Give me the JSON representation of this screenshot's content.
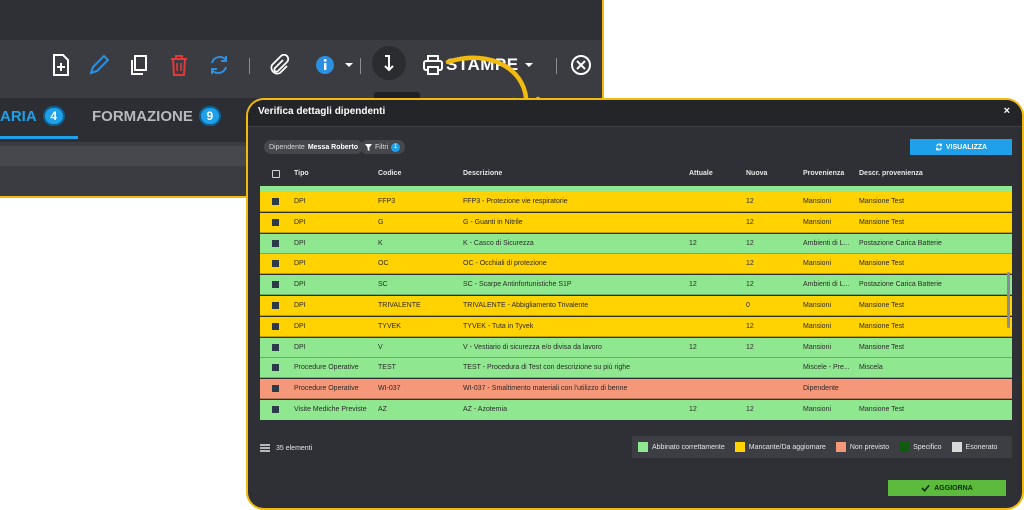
{
  "toolbar": {
    "print_label": "STAMPE"
  },
  "tabs": [
    {
      "label": "ARIA",
      "count": "4"
    },
    {
      "label": "FORMAZIONE",
      "count": "9"
    }
  ],
  "dialog": {
    "title": "Verifica dettagli dipendenti",
    "close": "×",
    "employee_chip_label": "Dipendente",
    "employee_chip_value": "Messa Roberto",
    "filter_chip_label": "Filtri",
    "filter_count": "1",
    "visualizza_label": "VISUALIZZA",
    "aggiorna_label": "AGGIORNA",
    "count_label": "35 elementi"
  },
  "table": {
    "headers": [
      "Tipo",
      "Codice",
      "Descrizione",
      "Attuale",
      "Nuova",
      "Provenienza",
      "Descr. provenienza"
    ],
    "rows": [
      {
        "status": "mancante",
        "tipo": "DPI",
        "codice": "FFP3",
        "descrizione": "FFP3 - Protezione vie respiratorie",
        "attuale": "",
        "nuova": "12",
        "provenienza": "Mansioni",
        "descr_provenienza": "Mansione Test"
      },
      {
        "status": "mancante",
        "tipo": "DPI",
        "codice": "G",
        "descrizione": "G - Guanti in Nitrile",
        "attuale": "",
        "nuova": "12",
        "provenienza": "Mansioni",
        "descr_provenienza": "Mansione Test"
      },
      {
        "status": "abbinato",
        "tipo": "DPI",
        "codice": "K",
        "descrizione": "K - Casco di Sicurezza",
        "attuale": "12",
        "nuova": "12",
        "provenienza": "Ambienti di L...",
        "descr_provenienza": "Postazione Carica Batterie"
      },
      {
        "status": "mancante",
        "tipo": "DPI",
        "codice": "OC",
        "descrizione": "OC - Occhiali di protezione",
        "attuale": "",
        "nuova": "12",
        "provenienza": "Mansioni",
        "descr_provenienza": "Mansione Test"
      },
      {
        "status": "abbinato",
        "tipo": "DPI",
        "codice": "SC",
        "descrizione": "SC - Scarpe Antinfortunistiche S1P",
        "attuale": "12",
        "nuova": "12",
        "provenienza": "Ambienti di L...",
        "descr_provenienza": "Postazione Carica Batterie"
      },
      {
        "status": "mancante",
        "tipo": "DPI",
        "codice": "TRIVALENTE",
        "descrizione": "TRIVALENTE - Abbigliamento Trivalente",
        "attuale": "",
        "nuova": "0",
        "provenienza": "Mansioni",
        "descr_provenienza": "Mansione Test"
      },
      {
        "status": "mancante",
        "tipo": "DPI",
        "codice": "TYVEK",
        "descrizione": "TYVEK - Tuta in Tyvek",
        "attuale": "",
        "nuova": "12",
        "provenienza": "Mansioni",
        "descr_provenienza": "Mansione Test"
      },
      {
        "status": "abbinato",
        "tipo": "DPI",
        "codice": "V",
        "descrizione": "V - Vestiario di sicurezza e/o divisa da lavoro",
        "attuale": "12",
        "nuova": "12",
        "provenienza": "Mansioni",
        "descr_provenienza": "Mansione Test"
      },
      {
        "status": "abbinato",
        "tipo": "Procedure Operative",
        "codice": "TEST",
        "descrizione": "TEST - Procedura di Test con descrizione su più righe",
        "attuale": "",
        "nuova": "",
        "provenienza": "Miscele - Pre...",
        "descr_provenienza": "Miscela"
      },
      {
        "status": "non_previsto",
        "tipo": "Procedure Operative",
        "codice": "WI-037",
        "descrizione": "WI-037 - Smaltimento materiali con l'utilizzo di benne",
        "attuale": "",
        "nuova": "",
        "provenienza": "Dipendente",
        "descr_provenienza": ""
      },
      {
        "status": "abbinato",
        "tipo": "Visite Mediche Previste",
        "codice": "AZ",
        "descrizione": "AZ - Azotemia",
        "attuale": "12",
        "nuova": "12",
        "provenienza": "Mansioni",
        "descr_provenienza": "Mansione Test"
      }
    ]
  },
  "legend": [
    {
      "key": "abbinato",
      "label": "Abbinato correttamente",
      "color": "#8fe88f"
    },
    {
      "key": "mancante",
      "label": "Mancante/Da aggiornare",
      "color": "#ffd200"
    },
    {
      "key": "non_previsto",
      "label": "Non previsto",
      "color": "#f5987a"
    },
    {
      "key": "specifico",
      "label": "Specifico",
      "color": "#0f5a0f"
    },
    {
      "key": "esonerato",
      "label": "Esonerato",
      "color": "#d9d9d9"
    }
  ]
}
